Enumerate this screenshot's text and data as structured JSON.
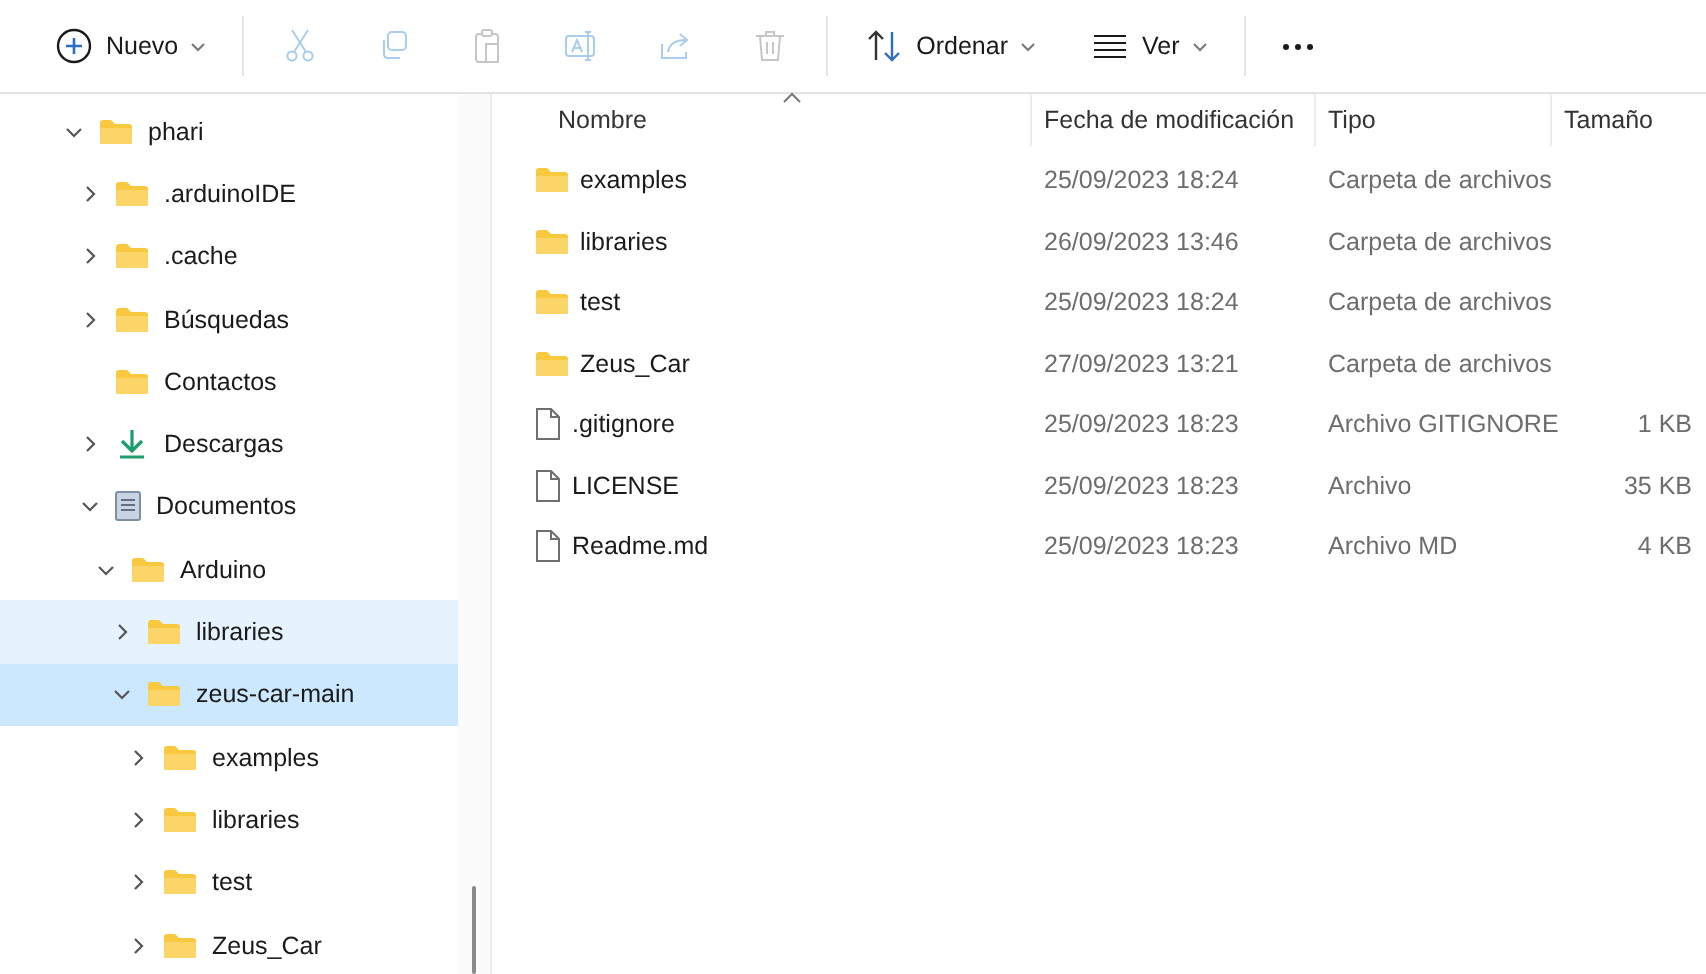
{
  "toolbar": {
    "groups": [
      [
        {
          "kind": "new",
          "label": "Nuevo",
          "menu": true,
          "disabled": false
        }
      ],
      [
        {
          "kind": "cut",
          "disabled": true
        },
        {
          "kind": "copy",
          "disabled": true
        },
        {
          "kind": "paste",
          "disabled": true
        },
        {
          "kind": "rename",
          "disabled": true
        },
        {
          "kind": "share",
          "disabled": true
        },
        {
          "kind": "delete",
          "disabled": true
        }
      ],
      [
        {
          "kind": "sort",
          "label": "Ordenar",
          "menu": true,
          "disabled": false
        },
        {
          "kind": "view",
          "label": "Ver",
          "menu": true,
          "disabled": false
        }
      ],
      [
        {
          "kind": "more",
          "disabled": false
        }
      ]
    ]
  },
  "sidebar": {
    "tree": [
      {
        "label": "phari",
        "kind": "folder",
        "expandable": true,
        "expanded": true,
        "selected": false,
        "hovered": false,
        "children": [
          {
            "label": ".arduinoIDE",
            "kind": "folder",
            "expandable": true,
            "expanded": false,
            "selected": false,
            "hovered": false
          },
          {
            "label": ".cache",
            "kind": "folder",
            "expandable": true,
            "expanded": false,
            "selected": false,
            "hovered": false
          },
          {
            "label": "Búsquedas",
            "kind": "folder",
            "expandable": true,
            "expanded": false,
            "selected": false,
            "hovered": false
          },
          {
            "label": "Contactos",
            "kind": "folder",
            "expandable": false,
            "expanded": false,
            "selected": false,
            "hovered": false
          },
          {
            "label": "Descargas",
            "kind": "downloads",
            "expandable": true,
            "expanded": false,
            "selected": false,
            "hovered": false
          },
          {
            "label": "Documentos",
            "kind": "documents",
            "expandable": true,
            "expanded": true,
            "selected": false,
            "hovered": false,
            "children": [
              {
                "label": "Arduino",
                "kind": "folder",
                "expandable": true,
                "expanded": true,
                "selected": false,
                "hovered": false,
                "children": [
                  {
                    "label": "libraries",
                    "kind": "folder",
                    "expandable": true,
                    "expanded": false,
                    "selected": false,
                    "hovered": true
                  },
                  {
                    "label": "zeus-car-main",
                    "kind": "folder",
                    "expandable": true,
                    "expanded": true,
                    "selected": true,
                    "hovered": false,
                    "children": [
                      {
                        "label": "examples",
                        "kind": "folder",
                        "expandable": true,
                        "expanded": false,
                        "selected": false,
                        "hovered": false
                      },
                      {
                        "label": "libraries",
                        "kind": "folder",
                        "expandable": true,
                        "expanded": false,
                        "selected": false,
                        "hovered": false
                      },
                      {
                        "label": "test",
                        "kind": "folder",
                        "expandable": true,
                        "expanded": false,
                        "selected": false,
                        "hovered": false
                      },
                      {
                        "label": "Zeus_Car",
                        "kind": "folder",
                        "expandable": true,
                        "expanded": false,
                        "selected": false,
                        "hovered": false
                      }
                    ]
                  }
                ]
              }
            ]
          }
        ]
      }
    ]
  },
  "table": {
    "columns": [
      {
        "label": "Nombre",
        "sorted": true
      },
      {
        "label": "Fecha de modificación",
        "sorted": false
      },
      {
        "label": "Tipo",
        "sorted": false
      },
      {
        "label": "Tamaño",
        "sorted": false
      }
    ],
    "rows": [
      {
        "kind": "folder",
        "name": "examples",
        "modified": "25/09/2023 18:24",
        "type": "Carpeta de archivos"
      },
      {
        "kind": "folder",
        "name": "libraries",
        "modified": "26/09/2023 13:46",
        "type": "Carpeta de archivos"
      },
      {
        "kind": "folder",
        "name": "test",
        "modified": "25/09/2023 18:24",
        "type": "Carpeta de archivos"
      },
      {
        "kind": "folder",
        "name": "Zeus_Car",
        "modified": "27/09/2023 13:21",
        "type": "Carpeta de archivos"
      },
      {
        "kind": "file",
        "name": ".gitignore",
        "modified": "25/09/2023 18:23",
        "type": "Archivo GITIGNORE",
        "size": "1 KB"
      },
      {
        "kind": "file",
        "name": "LICENSE",
        "modified": "25/09/2023 18:23",
        "type": "Archivo",
        "size": "35 KB"
      },
      {
        "kind": "file",
        "name": "Readme.md",
        "modified": "25/09/2023 18:23",
        "type": "Archivo MD",
        "size": "4 KB"
      }
    ]
  }
}
